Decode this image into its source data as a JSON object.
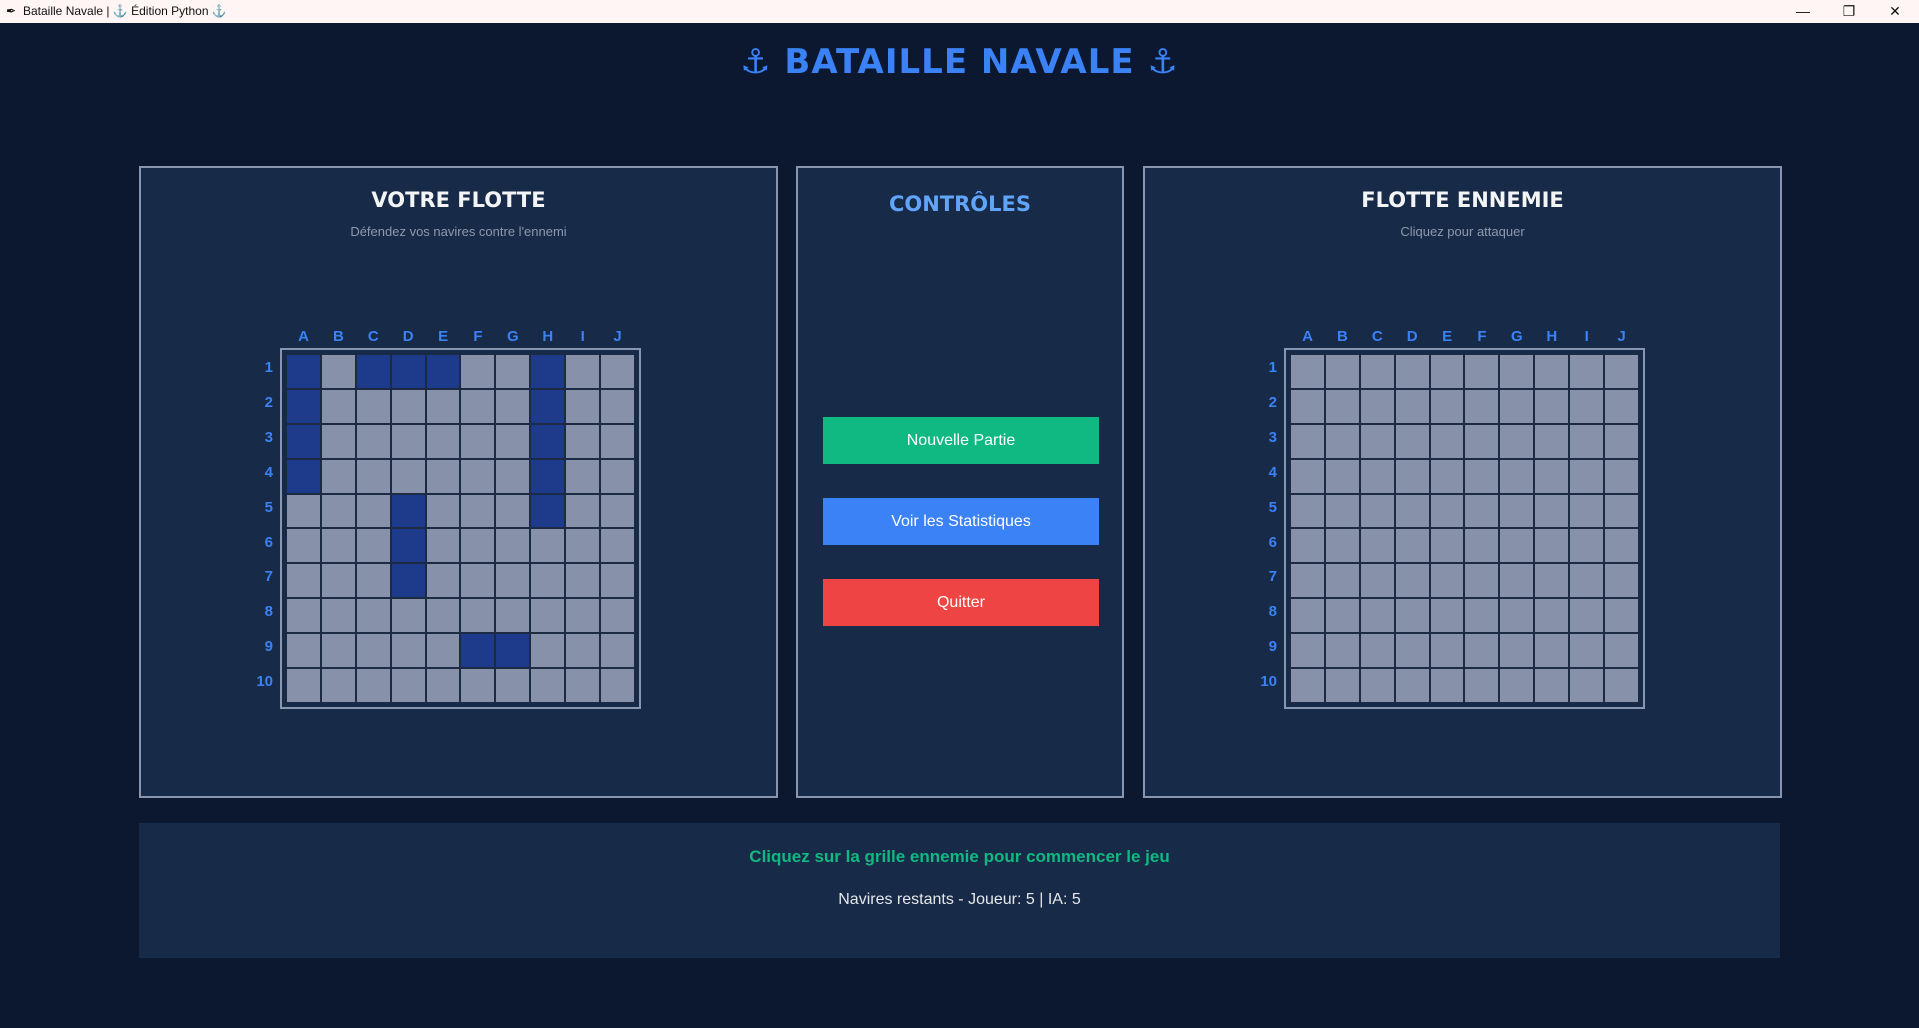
{
  "window": {
    "title": "Bataille Navale | ⚓ Édition Python ⚓",
    "app_icon": "feather-icon",
    "minimize_glyph": "—",
    "maximize_glyph": "❐",
    "close_glyph": "✕"
  },
  "header": {
    "title": "⚓ BATAILLE NAVALE ⚓"
  },
  "player": {
    "title": "VOTRE FLOTTE",
    "subtitle": "Défendez vos navires contre l'ennemi",
    "ships": [
      "A1",
      "C1",
      "D1",
      "E1",
      "H1",
      "A2",
      "H2",
      "A3",
      "H3",
      "A4",
      "H4",
      "D5",
      "H5",
      "D6",
      "D7",
      "F9",
      "G9"
    ]
  },
  "enemy": {
    "title": "FLOTTE ENNEMIE",
    "subtitle": "Cliquez pour attaquer"
  },
  "board": {
    "columns": [
      "A",
      "B",
      "C",
      "D",
      "E",
      "F",
      "G",
      "H",
      "I",
      "J"
    ],
    "rows": [
      "1",
      "2",
      "3",
      "4",
      "5",
      "6",
      "7",
      "8",
      "9",
      "10"
    ]
  },
  "controls": {
    "title": "CONTRÔLES",
    "new_game": "Nouvelle Partie",
    "stats": "Voir les Statistiques",
    "quit": "Quitter"
  },
  "status": {
    "message": "Cliquez sur la grille ennemie pour commencer le jeu",
    "ships_remaining": "Navires restants - Joueur: 5 | IA: 5"
  },
  "colors": {
    "background": "#0b1830",
    "panel": "#172a47",
    "accent": "#3b82f6",
    "ship": "#1e3a8a",
    "water": "#8891aa",
    "new_game_button": "#10b981",
    "stats_button": "#3b82f6",
    "quit_button": "#ef4444",
    "status_message": "#10b981"
  }
}
